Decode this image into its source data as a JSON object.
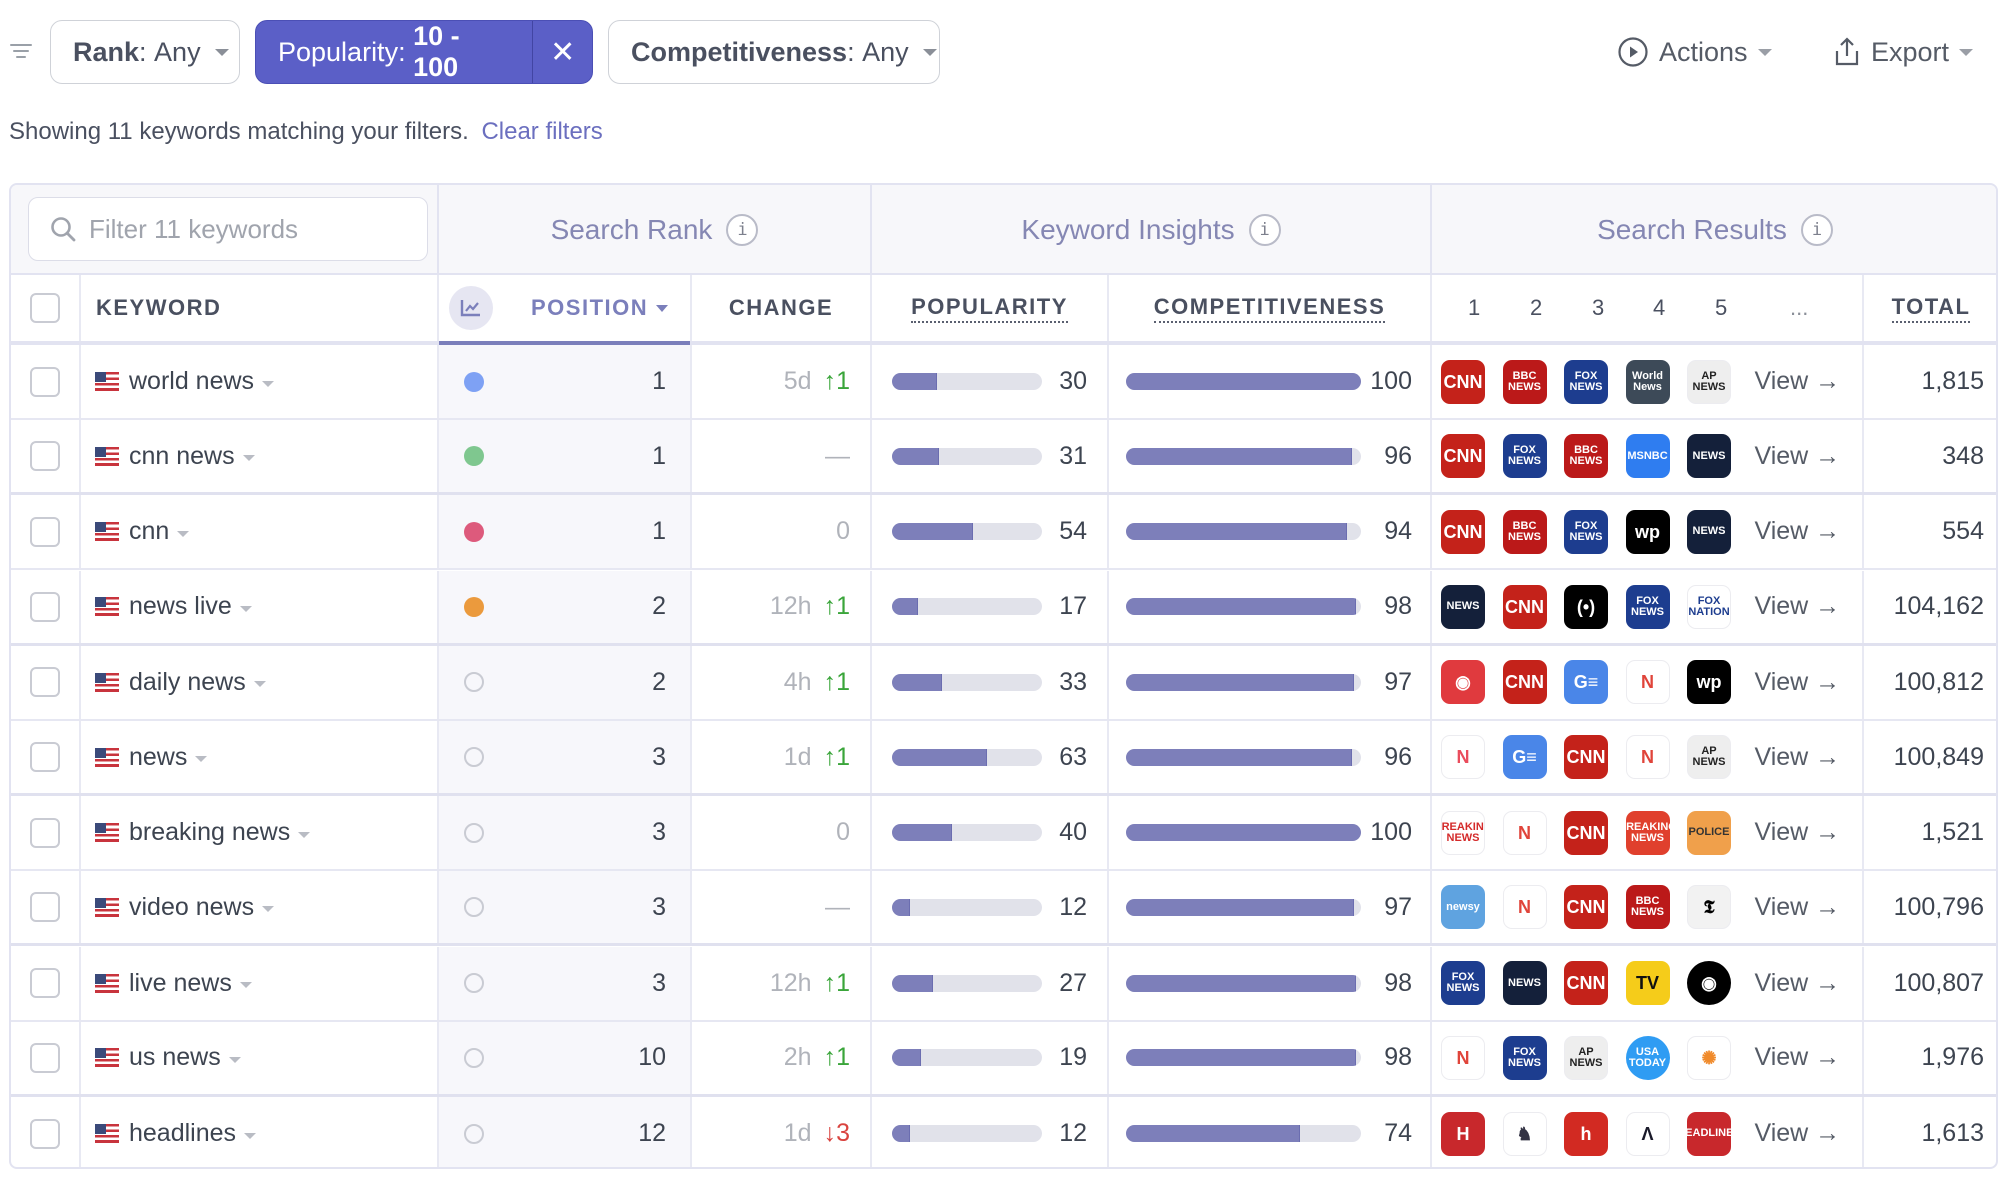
{
  "filters": {
    "rank": {
      "label": "Rank",
      "value": "Any"
    },
    "popularity": {
      "label": "Popularity:",
      "value": "10 - 100"
    },
    "competitiveness": {
      "label": "Competitiveness",
      "value": "Any"
    }
  },
  "toolbar": {
    "actions_label": "Actions",
    "export_label": "Export"
  },
  "status": {
    "text": "Showing 11 keywords matching your filters.",
    "clear_label": "Clear filters"
  },
  "table": {
    "search_placeholder": "Filter 11 keywords",
    "groups": {
      "search_rank": "Search Rank",
      "keyword_insights": "Keyword Insights",
      "search_results": "Search Results"
    },
    "columns": {
      "keyword": "KEYWORD",
      "position": "POSITION",
      "change": "CHANGE",
      "popularity": "POPULARITY",
      "competitiveness": "COMPETITIVENESS",
      "r1": "1",
      "r2": "2",
      "r3": "3",
      "r4": "4",
      "r5": "5",
      "more": "...",
      "total": "TOTAL"
    },
    "view_label": "View →",
    "rows": [
      {
        "keyword": "world news",
        "dot": "#7ea1f4",
        "position": "1",
        "change_time": "5d",
        "change_dir": "up",
        "change_val": "↑1",
        "popularity": 30,
        "competitiveness": 100,
        "results": [
          "cnn",
          "bbc",
          "fox",
          "worldnews",
          "ap"
        ],
        "total": "1,815"
      },
      {
        "keyword": "cnn news",
        "dot": "#7fc78f",
        "position": "1",
        "change_time": "",
        "change_dir": "none",
        "change_val": "—",
        "popularity": 31,
        "competitiveness": 96,
        "results": [
          "cnn",
          "fox",
          "bbc",
          "msnbc",
          "nbcnews"
        ],
        "total": "348"
      },
      {
        "keyword": "cnn",
        "dot": "#dd5a7c",
        "position": "1",
        "change_time": "",
        "change_dir": "zero",
        "change_val": "0",
        "popularity": 54,
        "competitiveness": 94,
        "results": [
          "cnn",
          "bbc",
          "fox",
          "wp",
          "nbcnews"
        ],
        "total": "554"
      },
      {
        "keyword": "news live",
        "dot": "#eb9a3d",
        "position": "2",
        "change_time": "12h",
        "change_dir": "up",
        "change_val": "↑1",
        "popularity": 17,
        "competitiveness": 98,
        "results": [
          "nbcnews",
          "cnn",
          "broadcast",
          "fox",
          "foxnation"
        ],
        "total": "104,162"
      },
      {
        "keyword": "daily news",
        "dot": "",
        "position": "2",
        "change_time": "4h",
        "change_dir": "up",
        "change_val": "↑1",
        "popularity": 33,
        "competitiveness": 97,
        "results": [
          "radio",
          "cnn",
          "gnews",
          "newsbreak",
          "wp"
        ],
        "total": "100,812"
      },
      {
        "keyword": "news",
        "dot": "",
        "position": "3",
        "change_time": "1d",
        "change_dir": "up",
        "change_val": "↑1",
        "popularity": 63,
        "competitiveness": 96,
        "results": [
          "applenews",
          "gnews",
          "cnn",
          "newsbreak",
          "ap"
        ],
        "total": "100,849"
      },
      {
        "keyword": "breaking news",
        "dot": "",
        "position": "3",
        "change_time": "",
        "change_dir": "zero",
        "change_val": "0",
        "popularity": 40,
        "competitiveness": 100,
        "results": [
          "breaking",
          "newsbreak",
          "cnn",
          "breakingred",
          "police"
        ],
        "total": "1,521"
      },
      {
        "keyword": "video news",
        "dot": "",
        "position": "3",
        "change_time": "",
        "change_dir": "none",
        "change_val": "—",
        "popularity": 12,
        "competitiveness": 97,
        "results": [
          "newsy",
          "newsbreak",
          "cnn",
          "bbc",
          "nyt"
        ],
        "total": "100,796"
      },
      {
        "keyword": "live news",
        "dot": "",
        "position": "3",
        "change_time": "12h",
        "change_dir": "up",
        "change_val": "↑1",
        "popularity": 27,
        "competitiveness": 98,
        "results": [
          "fox",
          "nbcnews",
          "cnn",
          "freecable",
          "cbs"
        ],
        "total": "100,807"
      },
      {
        "keyword": "us news",
        "dot": "",
        "position": "10",
        "change_time": "2h",
        "change_dir": "up",
        "change_val": "↑1",
        "popularity": 19,
        "competitiveness": 98,
        "results": [
          "newsbreak",
          "fox",
          "ap",
          "usatoday",
          "reuters"
        ],
        "total": "1,976"
      },
      {
        "keyword": "headlines",
        "dot": "",
        "position": "12",
        "change_time": "1d",
        "change_dir": "down",
        "change_val": "↓3",
        "popularity": 12,
        "competitiveness": 74,
        "results": [
          "hnews",
          "mascot",
          "hred",
          "axios",
          "headlinesradio"
        ],
        "total": "1,613"
      }
    ]
  },
  "logos": {
    "cnn": {
      "name": "CNN",
      "text": "CNN",
      "bg": "#c4221a",
      "fg": "#ffffff"
    },
    "bbc": {
      "name": "BBC News",
      "text": "BBC NEWS",
      "bg": "#bb1919",
      "fg": "#ffffff"
    },
    "fox": {
      "name": "Fox News",
      "text": "FOX NEWS",
      "bg": "#1d3d8f",
      "fg": "#ffffff"
    },
    "worldnews": {
      "name": "World News",
      "text": "World News",
      "bg": "#3d4a58",
      "fg": "#ffffff"
    },
    "ap": {
      "name": "AP News",
      "text": "AP NEWS",
      "bg": "#eeeeee",
      "fg": "#222222"
    },
    "msnbc": {
      "name": "MSNBC",
      "text": "MSNBC",
      "bg": "#2f7df0",
      "fg": "#ffffff"
    },
    "nbcnews": {
      "name": "NBC News",
      "text": "NEWS",
      "bg": "#14203a",
      "fg": "#ffffff"
    },
    "wp": {
      "name": "Washington Post",
      "text": "wp",
      "bg": "#000000",
      "fg": "#ffffff"
    },
    "broadcast": {
      "name": "Broadcast",
      "text": "(•)",
      "bg": "#000000",
      "fg": "#ffffff"
    },
    "foxnation": {
      "name": "Fox Nation",
      "text": "FOX NATION",
      "bg": "#ffffff",
      "fg": "#1d3d8f"
    },
    "radio": {
      "name": "Radio App",
      "text": "◉",
      "bg": "#e03a3e",
      "fg": "#ffffff"
    },
    "gnews": {
      "name": "Google News",
      "text": "G≡",
      "bg": "#4a86e8",
      "fg": "#ffffff"
    },
    "newsbreak": {
      "name": "NewsBreak",
      "text": "N",
      "bg": "#ffffff",
      "fg": "#e0443a"
    },
    "applenews": {
      "name": "Apple News",
      "text": "N",
      "bg": "#ffffff",
      "fg": "#ea4c5c"
    },
    "breaking": {
      "name": "Breaking News",
      "text": "BREAKING NEWS",
      "bg": "#ffffff",
      "fg": "#d42a2a"
    },
    "breakingred": {
      "name": "Breaking News Red",
      "text": "BREAKING NEWS",
      "bg": "#e0402d",
      "fg": "#ffffff"
    },
    "police": {
      "name": "Police Scanner",
      "text": "POLICE",
      "bg": "#f0a04b",
      "fg": "#333333"
    },
    "newsy": {
      "name": "Newsy",
      "text": "newsy",
      "bg": "#5fa3e0",
      "fg": "#ffffff"
    },
    "nyt": {
      "name": "New York Times",
      "text": "𝕿",
      "bg": "#f2f2f2",
      "fg": "#000000"
    },
    "freecable": {
      "name": "FreeCable TV",
      "text": "TV",
      "bg": "#f5cc1a",
      "fg": "#111111"
    },
    "cbs": {
      "name": "CBS News",
      "text": "◉",
      "bg": "#000000",
      "fg": "#ffffff"
    },
    "usatoday": {
      "name": "USA Today",
      "text": "USA TODAY",
      "bg": "#2f9cf3",
      "fg": "#ffffff"
    },
    "reuters": {
      "name": "Reuters",
      "text": "✺",
      "bg": "#ffffff",
      "fg": "#f08a2a"
    },
    "hnews": {
      "name": "H News",
      "text": "H",
      "bg": "#c8282c",
      "fg": "#ffffff"
    },
    "mascot": {
      "name": "Mascot App",
      "text": "♞",
      "bg": "#ffffff",
      "fg": "#333344"
    },
    "hred": {
      "name": "H App",
      "text": "h",
      "bg": "#d22a22",
      "fg": "#ffffff"
    },
    "axios": {
      "name": "Axios",
      "text": "Λ",
      "bg": "#ffffff",
      "fg": "#1a1a2a"
    },
    "headlinesradio": {
      "name": "Headlines Radio Show",
      "text": "HEADLINES",
      "bg": "#c8282c",
      "fg": "#ffffff"
    }
  },
  "colors": {
    "accent": "#5b5fc7",
    "bar_fill": "#7d7fba",
    "bar_track": "#e1e2ea",
    "up": "#3aa53a",
    "down": "#d9433f"
  }
}
